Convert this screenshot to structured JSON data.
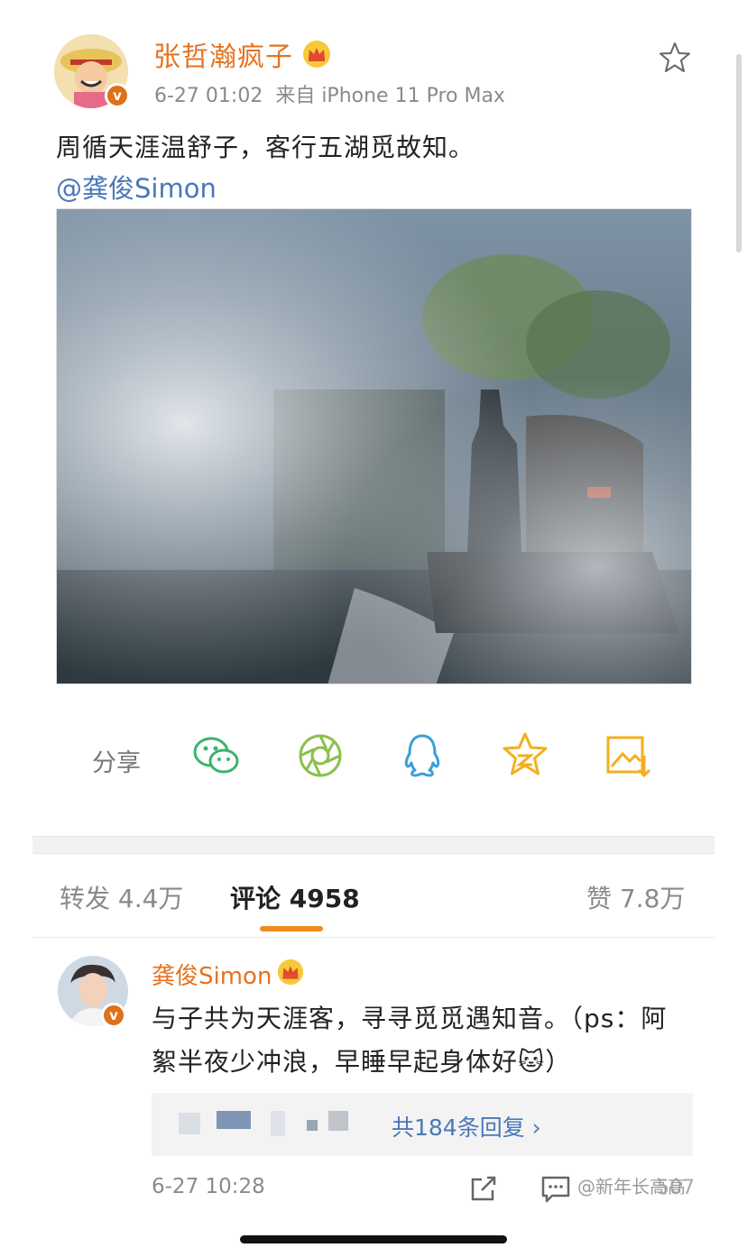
{
  "post": {
    "author": "张哲瀚疯子",
    "time": "6-27 01:02",
    "source": "来自 iPhone 11 Pro Max",
    "text": "周循天涯温舒子，客行五湖觅故知。",
    "mention": "@龚俊Simon",
    "verified_badge": "v"
  },
  "share": {
    "label": "分享",
    "icons": [
      "wechat-icon",
      "moments-icon",
      "qq-icon",
      "qzone-icon",
      "save-image-icon"
    ]
  },
  "tabs": {
    "repost": "转发 4.4万",
    "comments": "评论 4958",
    "likes": "赞 7.8万"
  },
  "comment": {
    "author": "龚俊Simon",
    "text": "与子共为天涯客，寻寻觅觅遇知音。（ps：阿絮半夜少冲浪，早睡早起身体好🐱）",
    "replies": "共184条回复 ›",
    "time": "6-27 10:28",
    "like_count": "507",
    "verified_badge": "v"
  },
  "watermark": "@新年长高高",
  "colors": {
    "author_orange": "#e5731f",
    "link_blue": "#4a78b8",
    "tab_accent": "#f28a1f",
    "wechat": "#3bb36b",
    "moments": "#8cc04a",
    "qq": "#3a9fd8",
    "qzone": "#f2b01e",
    "save": "#f2b01e"
  }
}
